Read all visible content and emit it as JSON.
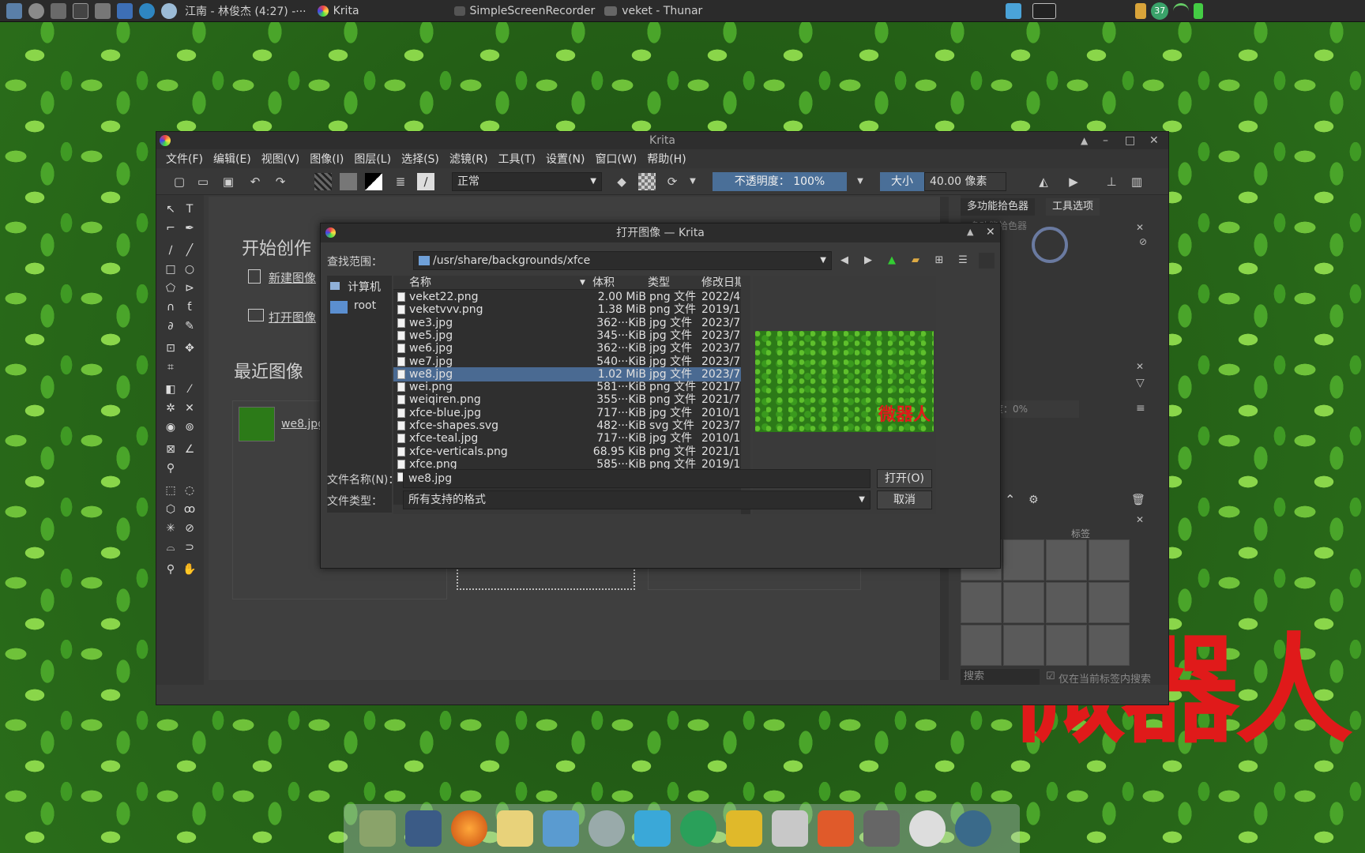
{
  "top_panel": {
    "now_playing": "江南 - 林俊杰 (4:27) -···",
    "krita_task": "Krita",
    "recorder_task": "SimpleScreenRecorder",
    "thunar_task": "veket - Thunar",
    "temperature": "37"
  },
  "watermark": "微器人",
  "krita": {
    "title": "Krita",
    "menu": [
      "文件(F)",
      "编辑(E)",
      "视图(V)",
      "图像(I)",
      "图层(L)",
      "选择(S)",
      "滤镜(R)",
      "工具(T)",
      "设置(N)",
      "窗口(W)",
      "帮助(H)"
    ],
    "blend_mode": "正常",
    "opacity": "不透明度： 100%",
    "size_label": "大小",
    "size_value": "40.00 像素",
    "welcome": {
      "start_title": "开始创作",
      "new_image": "新建图像",
      "open_image": "打开图像",
      "recent_title": "最近图像",
      "recent_file": "we8.jpg"
    },
    "dockers": {
      "tab_color": "多功能拾色器",
      "tab_tool": "工具选项",
      "color_sub": "多功能拾色器",
      "layer_opacity": "不透明度：0%",
      "preset_title": "预设",
      "tag_label": "标签",
      "search_placeholder": "搜索",
      "search_tag_only": "仅在当前标签内搜索"
    }
  },
  "dialog": {
    "title": "打开图像 — Krita",
    "look_in_label": "查找范围：",
    "path": "/usr/share/backgrounds/xfce",
    "places": [
      "计算机",
      "root"
    ],
    "columns": [
      "名称",
      "体积",
      "类型",
      "修改日期"
    ],
    "files": [
      {
        "name": "veket22.png",
        "size": "2.00 MiB",
        "type": "png 文件",
        "date": "2022/4"
      },
      {
        "name": "veketvvv.png",
        "size": "1.38 MiB",
        "type": "png 文件",
        "date": "2019/1"
      },
      {
        "name": "we3.jpg",
        "size": "362···KiB",
        "type": "jpg 文件",
        "date": "2023/7"
      },
      {
        "name": "we5.jpg",
        "size": "345···KiB",
        "type": "jpg 文件",
        "date": "2023/7"
      },
      {
        "name": "we6.jpg",
        "size": "362···KiB",
        "type": "jpg 文件",
        "date": "2023/7"
      },
      {
        "name": "we7.jpg",
        "size": "540···KiB",
        "type": "jpg 文件",
        "date": "2023/7"
      },
      {
        "name": "we8.jpg",
        "size": "1.02 MiB",
        "type": "jpg 文件",
        "date": "2023/7",
        "selected": true
      },
      {
        "name": "wei.png",
        "size": "581···KiB",
        "type": "png 文件",
        "date": "2021/7"
      },
      {
        "name": "weiqiren.png",
        "size": "355···KiB",
        "type": "png 文件",
        "date": "2021/7"
      },
      {
        "name": "xfce-blue.jpg",
        "size": "717···KiB",
        "type": "jpg 文件",
        "date": "2010/1"
      },
      {
        "name": "xfce-shapes.svg",
        "size": "482···KiB",
        "type": "svg 文件",
        "date": "2023/7"
      },
      {
        "name": "xfce-teal.jpg",
        "size": "717···KiB",
        "type": "jpg 文件",
        "date": "2010/1"
      },
      {
        "name": "xfce-verticals.png",
        "size": "68.95 KiB",
        "type": "png 文件",
        "date": "2021/1"
      },
      {
        "name": "xfce.png",
        "size": "585···KiB",
        "type": "png 文件",
        "date": "2019/1"
      },
      {
        "name": "xfce.svg",
        "size": "514···KiB",
        "type": "svg 文件",
        "date": "2023/7"
      }
    ],
    "preview_watermark": "微器人",
    "filename_label": "文件名称(N)：",
    "filename_value": "we8.jpg",
    "filetype_label": "文件类型：",
    "filetype_value": "所有支持的格式",
    "open_button": "打开(O)",
    "cancel_button": "取消"
  }
}
